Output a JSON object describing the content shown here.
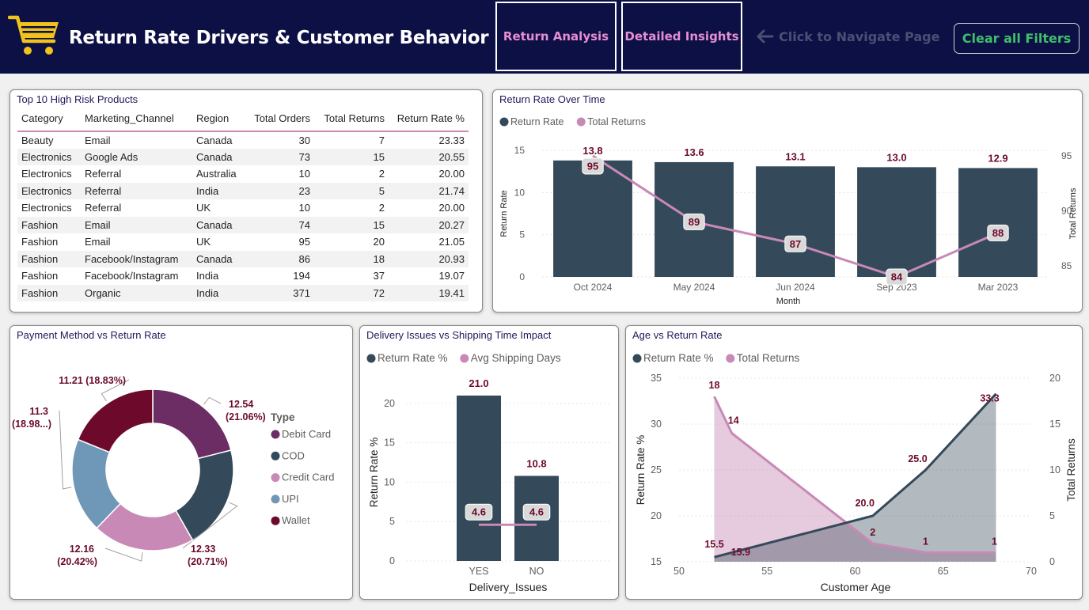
{
  "header": {
    "title": "Return Rate Drivers & Customer Behavior",
    "logo_icon": "shopping-cart-icon",
    "nav_return_analysis": "Return Analysis",
    "nav_detailed_insights": "Detailed Insights",
    "nav_hint": "Click to Navigate Page",
    "clear_filters": "Clear all Filters"
  },
  "colors": {
    "navy": "#0c1045",
    "dark": "#34495a",
    "pink": "#c889b6",
    "plum": "#6b2d63",
    "blue": "#6f97b8",
    "wine": "#6d0a2c",
    "green": "#3fbf6a"
  },
  "products_table": {
    "title": "Top 10 High Risk Products",
    "columns": [
      "Category",
      "Marketing_Channel",
      "Region",
      "Total Orders",
      "Total Returns",
      "Return Rate %"
    ],
    "rows": [
      [
        "Beauty",
        "Email",
        "Canada",
        "30",
        "7",
        "23.33"
      ],
      [
        "Electronics",
        "Google Ads",
        "Canada",
        "73",
        "15",
        "20.55"
      ],
      [
        "Electronics",
        "Referral",
        "Australia",
        "10",
        "2",
        "20.00"
      ],
      [
        "Electronics",
        "Referral",
        "India",
        "23",
        "5",
        "21.74"
      ],
      [
        "Electronics",
        "Referral",
        "UK",
        "10",
        "2",
        "20.00"
      ],
      [
        "Fashion",
        "Email",
        "Canada",
        "74",
        "15",
        "20.27"
      ],
      [
        "Fashion",
        "Email",
        "UK",
        "95",
        "20",
        "21.05"
      ],
      [
        "Fashion",
        "Facebook/Instagram",
        "Canada",
        "86",
        "18",
        "20.93"
      ],
      [
        "Fashion",
        "Facebook/Instagram",
        "India",
        "194",
        "37",
        "19.07"
      ],
      [
        "Fashion",
        "Organic",
        "India",
        "371",
        "72",
        "19.41"
      ]
    ]
  },
  "chart_data": [
    {
      "type": "bar",
      "title": "Return Rate Over Time",
      "xlabel": "Month",
      "ylabel": "Return Rate",
      "y2label": "Total Returns",
      "categories": [
        "Oct 2024",
        "May 2024",
        "Jun 2024",
        "Sep 2023",
        "Mar 2023"
      ],
      "ylim": [
        0,
        15
      ],
      "y_ticks": [
        0,
        5,
        10,
        15
      ],
      "y2lim": [
        84,
        95.5
      ],
      "y2_ticks": [
        85,
        90,
        95
      ],
      "legend": "top-left",
      "series": [
        {
          "name": "Return Rate",
          "kind": "bar",
          "values": [
            13.8,
            13.6,
            13.1,
            13.0,
            12.9
          ],
          "labels": [
            "13.8",
            "13.6",
            "13.1",
            "13.0",
            "12.9"
          ]
        },
        {
          "name": "Total Returns",
          "kind": "line",
          "axis": "right",
          "values": [
            95,
            89,
            87,
            84,
            88
          ],
          "labels": [
            "95",
            "89",
            "87",
            "84",
            "88"
          ]
        }
      ]
    },
    {
      "type": "pie",
      "title": "Payment Method vs Return Rate",
      "legend_title": "Type",
      "legend": "right",
      "slices": [
        {
          "name": "Debit Card",
          "value": 12.54,
          "label": "12.54",
          "pct_label": "(21.06%)"
        },
        {
          "name": "COD",
          "value": 12.33,
          "label": "12.33",
          "pct_label": "(20.71%)"
        },
        {
          "name": "Credit Card",
          "value": 12.16,
          "label": "12.16",
          "pct_label": "(20.42%)"
        },
        {
          "name": "UPI",
          "value": 11.3,
          "label": "11.3",
          "pct_label": "(18.98...)"
        },
        {
          "name": "Wallet",
          "value": 11.21,
          "label": "11.21",
          "pct_label": "(18.83%)"
        }
      ]
    },
    {
      "type": "bar",
      "title": "Delivery Issues vs Shipping Time Impact",
      "xlabel": "Delivery_Issues",
      "ylabel": "Return Rate %",
      "categories": [
        "YES",
        "NO"
      ],
      "ylim": [
        0,
        22
      ],
      "y_ticks": [
        0,
        5,
        10,
        15,
        20
      ],
      "legend": "top-left",
      "series": [
        {
          "name": "Return Rate %",
          "kind": "bar",
          "values": [
            21.0,
            10.8
          ],
          "labels": [
            "21.0",
            "10.8"
          ]
        },
        {
          "name": "Avg Shipping Days",
          "kind": "line",
          "values": [
            4.6,
            4.6
          ],
          "labels": [
            "4.6",
            "4.6"
          ]
        }
      ]
    },
    {
      "type": "area",
      "title": "Age vs Return Rate",
      "xlabel": "Customer Age",
      "ylabel": "Return Rate %",
      "y2label": "Total Returns",
      "xlim": [
        50,
        70
      ],
      "x_ticks": [
        50,
        55,
        60,
        65,
        70
      ],
      "ylim": [
        15,
        35
      ],
      "y_ticks": [
        15,
        20,
        25,
        30,
        35
      ],
      "y2lim": [
        0,
        20
      ],
      "y2_ticks": [
        0,
        5,
        10,
        15,
        20
      ],
      "legend": "top-left",
      "series": [
        {
          "name": "Return Rate %",
          "kind": "area",
          "x": [
            52,
            61,
            64,
            68
          ],
          "values": [
            15.5,
            20.0,
            25.0,
            33.3
          ],
          "labels": [
            "15.5",
            "20.0",
            "25.0",
            "33.3"
          ]
        },
        {
          "name": "Total Returns",
          "kind": "area",
          "axis": "right",
          "x": [
            52,
            53,
            61,
            64,
            68
          ],
          "values": [
            18,
            14,
            2,
            1,
            1
          ],
          "labels": [
            "18",
            "14",
            "2",
            "1",
            "1"
          ]
        }
      ],
      "annotations": [
        "15.9"
      ]
    }
  ]
}
